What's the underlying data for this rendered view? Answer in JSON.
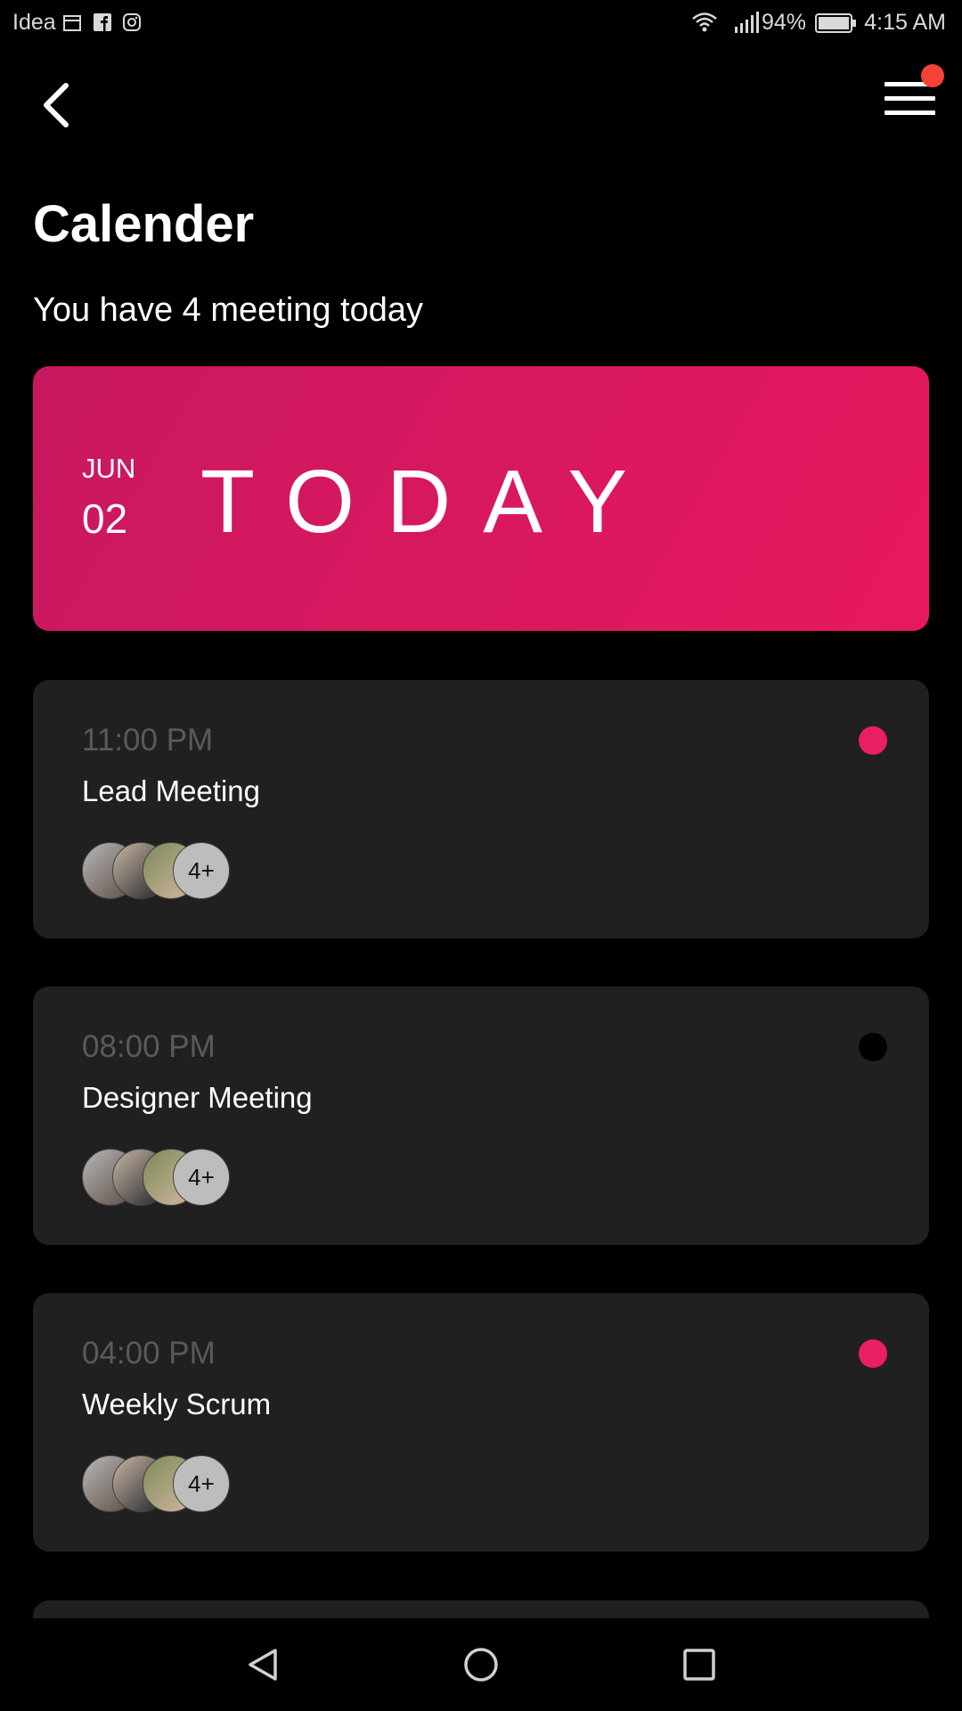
{
  "status_bar": {
    "carrier": "Idea",
    "battery": "94%",
    "time": "4:15 AM"
  },
  "header": {
    "title": "Calender",
    "subtitle": "You have 4 meeting today"
  },
  "today_banner": {
    "month": "JUN",
    "day": "02",
    "label": "TODAY",
    "gradient_start": "#c8185f",
    "gradient_end": "#e8185f"
  },
  "meetings": [
    {
      "time": "11:00 PM",
      "title": "Lead Meeting",
      "more": "4+",
      "dot_color": "#e91e63"
    },
    {
      "time": "08:00 PM",
      "title": "Designer Meeting",
      "more": "4+",
      "dot_color": "#000000"
    },
    {
      "time": "04:00 PM",
      "title": "Weekly Scrum",
      "more": "4+",
      "dot_color": "#e91e63"
    }
  ],
  "colors": {
    "accent": "#e91e63",
    "notification": "#f44336",
    "card_bg": "#202020",
    "time_text": "#5a5a5a"
  },
  "icons": {
    "back": "back-arrow-icon",
    "menu": "hamburger-menu-icon",
    "nav_back": "triangle-back-icon",
    "nav_home": "circle-home-icon",
    "nav_recent": "square-recents-icon"
  }
}
